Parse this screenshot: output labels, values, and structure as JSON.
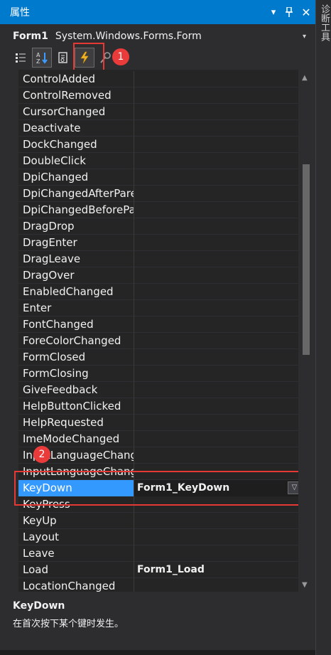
{
  "panel": {
    "title": "属性",
    "side_tab": "诊断工具"
  },
  "object": {
    "name": "Form1",
    "type": "System.Windows.Forms.Form"
  },
  "toolbar": {
    "icons": [
      "categorized-icon",
      "alphabetical-icon",
      "properties-icon",
      "events-icon",
      "property-pages-icon"
    ]
  },
  "annotations": {
    "badge1": "1",
    "badge2": "2"
  },
  "events": [
    {
      "name": "ControlAdded",
      "value": ""
    },
    {
      "name": "ControlRemoved",
      "value": ""
    },
    {
      "name": "CursorChanged",
      "value": ""
    },
    {
      "name": "Deactivate",
      "value": ""
    },
    {
      "name": "DockChanged",
      "value": ""
    },
    {
      "name": "DoubleClick",
      "value": ""
    },
    {
      "name": "DpiChanged",
      "value": ""
    },
    {
      "name": "DpiChangedAfterPare",
      "value": ""
    },
    {
      "name": "DpiChangedBeforePa",
      "value": ""
    },
    {
      "name": "DragDrop",
      "value": ""
    },
    {
      "name": "DragEnter",
      "value": ""
    },
    {
      "name": "DragLeave",
      "value": ""
    },
    {
      "name": "DragOver",
      "value": ""
    },
    {
      "name": "EnabledChanged",
      "value": ""
    },
    {
      "name": "Enter",
      "value": ""
    },
    {
      "name": "FontChanged",
      "value": ""
    },
    {
      "name": "ForeColorChanged",
      "value": ""
    },
    {
      "name": "FormClosed",
      "value": ""
    },
    {
      "name": "FormClosing",
      "value": ""
    },
    {
      "name": "GiveFeedback",
      "value": ""
    },
    {
      "name": "HelpButtonClicked",
      "value": ""
    },
    {
      "name": "HelpRequested",
      "value": ""
    },
    {
      "name": "ImeModeChanged",
      "value": ""
    },
    {
      "name": "InputLanguageChang",
      "value": ""
    },
    {
      "name": "InputLanguageChang",
      "value": ""
    },
    {
      "name": "KeyDown",
      "value": "Form1_KeyDown",
      "selected": true
    },
    {
      "name": "KeyPress",
      "value": ""
    },
    {
      "name": "KeyUp",
      "value": ""
    },
    {
      "name": "Layout",
      "value": ""
    },
    {
      "name": "Leave",
      "value": ""
    },
    {
      "name": "Load",
      "value": "Form1_Load"
    },
    {
      "name": "LocationChanged",
      "value": ""
    }
  ],
  "description": {
    "title": "KeyDown",
    "text": "在首次按下某个键时发生。"
  }
}
